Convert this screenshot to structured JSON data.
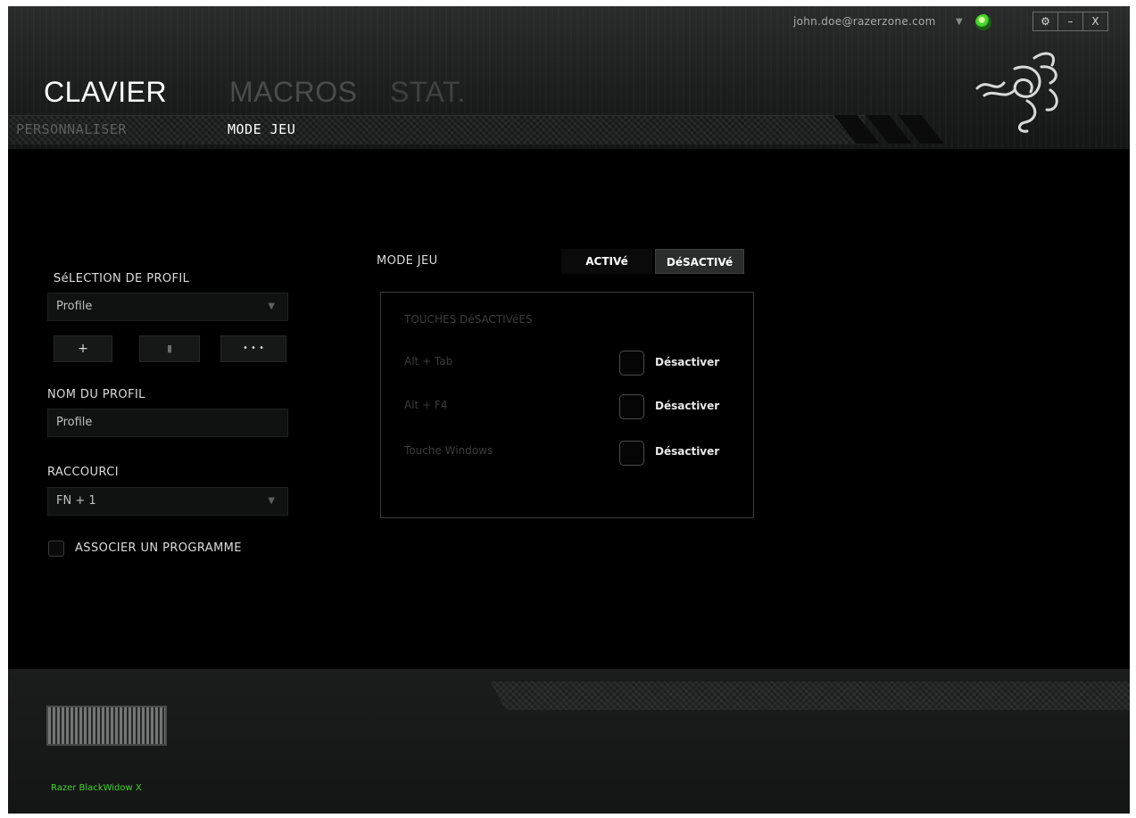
{
  "account": {
    "email": "john.doe@razerzone.com"
  },
  "window_controls": {
    "settings": "⚙",
    "minimize": "–",
    "close": "X"
  },
  "tabs": [
    {
      "label": "CLAVIER",
      "active": true
    },
    {
      "label": "MACROS",
      "active": false
    },
    {
      "label": "STAT.",
      "active": false
    }
  ],
  "subtabs": [
    {
      "label": "PERSONNALISER",
      "active": false
    },
    {
      "label": "MODE JEU",
      "active": true
    }
  ],
  "profile": {
    "selection_label": "SéLECTION DE PROFIL",
    "selected": "Profile",
    "buttons": {
      "add": "+",
      "delete": "▮",
      "more": "• • •"
    },
    "name_label": "NOM DU PROFIL",
    "name_value": "Profile",
    "shortcut_label": "RACCOURCI",
    "shortcut_value": "FN + 1",
    "associate_label": "ASSOCIER UN PROGRAMME"
  },
  "game_mode": {
    "label": "MODE JEU",
    "on_label": "ACTIVé",
    "off_label": "DéSACTIVé",
    "state": "off",
    "disabled_keys_title": "TOUCHES DéSACTIVéES",
    "keys": [
      {
        "name": "Alt + Tab",
        "action": "Désactiver"
      },
      {
        "name": "Alt + F4",
        "action": "Désactiver"
      },
      {
        "name": "Touche Windows",
        "action": "Désactiver"
      }
    ]
  },
  "device": {
    "name": "Razer BlackWidow X"
  },
  "colors": {
    "accent": "#44d62c",
    "background": "#000000"
  }
}
